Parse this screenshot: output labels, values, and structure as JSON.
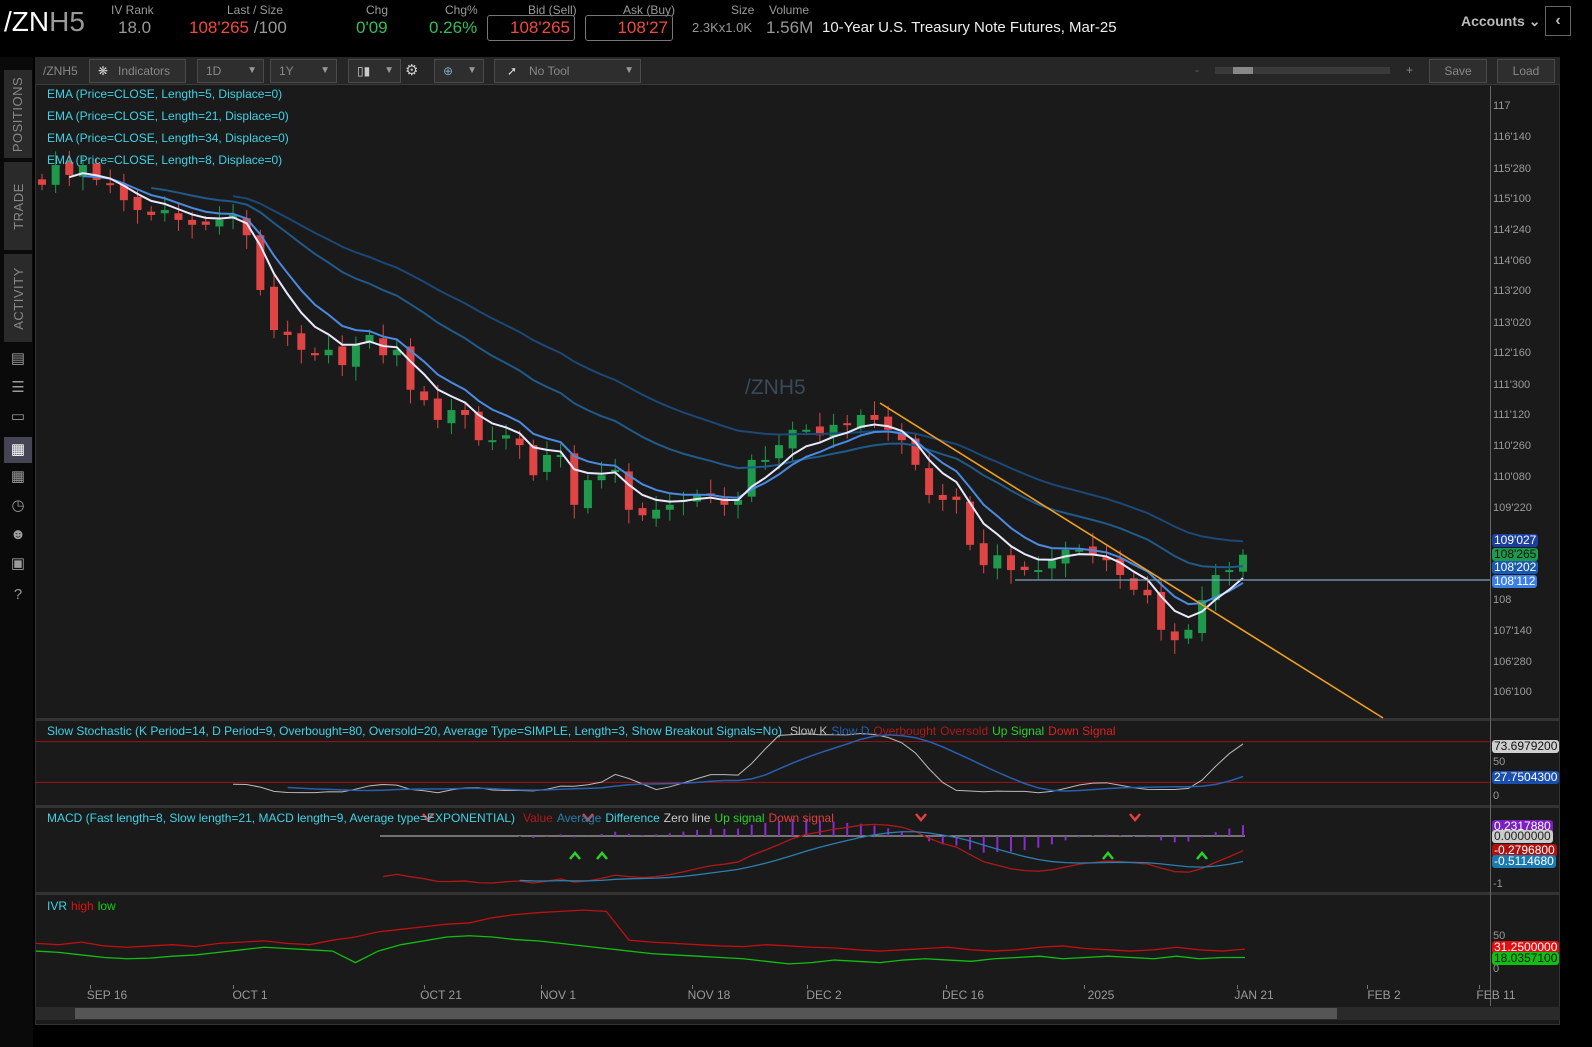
{
  "header": {
    "symbol_prefix": "/ZN",
    "symbol_suffix": "H5",
    "iv_rank_label": "IV Rank",
    "iv_rank": "18.0",
    "last_label": "Last / Size",
    "last": "108'265",
    "size": "/100",
    "chg_label": "Chg",
    "chg": "0'09",
    "chgpct_label": "Chg%",
    "chgpct": "0.26%",
    "bid_label": "Bid (Sell)",
    "bid": "108'265",
    "ask_label": "Ask (Buy)",
    "ask": "108'27",
    "size_label": "Size",
    "size_val": "2.3Kx1.0K",
    "volume_label": "Volume",
    "volume": "1.56M",
    "description": "10-Year U.S. Treasury Note Futures, Mar-25",
    "accounts": "Accounts"
  },
  "sidebar": {
    "tabs": [
      "POSITIONS",
      "TRADE",
      "ACTIVITY"
    ]
  },
  "toolbar": {
    "symbol": "/ZNH5",
    "indicators": "Indicators",
    "aggregation": "1D",
    "timeframe": "1Y",
    "tool": "No Tool",
    "zoom_minus": "-",
    "zoom_plus": "+",
    "save": "Save",
    "load": "Load"
  },
  "chart": {
    "watermark": "/ZNH5",
    "legends": [
      "EMA (Price=CLOSE, Length=5, Displace=0)",
      "EMA (Price=CLOSE, Length=21, Displace=0)",
      "EMA (Price=CLOSE, Length=34, Displace=0)",
      "EMA (Price=CLOSE, Length=8, Displace=0)"
    ],
    "price_ticks": [
      "117",
      "116'140",
      "115'280",
      "115'100",
      "114'240",
      "114'060",
      "113'200",
      "113'020",
      "112'160",
      "111'300",
      "111'120",
      "110'260",
      "110'080",
      "109'220",
      "108",
      "107'140",
      "106'280",
      "106'100"
    ],
    "price_tags": [
      {
        "text": "109'027",
        "color": "#1a3fa0"
      },
      {
        "text": "108'265",
        "color": "#1f9a4c"
      },
      {
        "text": "108'202",
        "color": "#1a5ab0"
      },
      {
        "text": "108'112",
        "color": "#3a7ee8"
      }
    ],
    "date_labels": [
      "SEP 16",
      "OCT 1",
      "OCT 21",
      "NOV 1",
      "NOV 18",
      "DEC 2",
      "DEC 16",
      "2025",
      "JAN 21",
      "FEB 2",
      "FEB 11"
    ]
  },
  "stochastic": {
    "title": "Slow Stochastic (K Period=14, D Period=9, Overbought=80, Oversold=20, Average Type=SIMPLE, Length=3, Show Breakout Signals=No)",
    "series": [
      {
        "label": "Slow K",
        "color": "#bbbbbb"
      },
      {
        "label": "Slow D",
        "color": "#2a5fb0"
      },
      {
        "label": "Overbought",
        "color": "#b01818"
      },
      {
        "label": "Oversold",
        "color": "#b01818"
      },
      {
        "label": "Up Signal",
        "color": "#2bd12b"
      },
      {
        "label": "Down Signal",
        "color": "#e02020"
      }
    ],
    "ticks": [
      "50",
      "0"
    ],
    "tags": [
      {
        "text": "73.6979200",
        "color": "#cfcfcf",
        "fg": "#111"
      },
      {
        "text": "27.7504300",
        "color": "#1a4fb0",
        "fg": "#fff"
      }
    ]
  },
  "macd": {
    "title": "MACD (Fast length=8, Slow length=21, MACD length=9, Average type=EXPONENTIAL)",
    "series": [
      {
        "label": "Value",
        "color": "#b01818"
      },
      {
        "label": "Average",
        "color": "#2a7fb0"
      },
      {
        "label": "Difference",
        "color": "#3fd2e6"
      },
      {
        "label": "Zero line",
        "color": "#cccccc"
      },
      {
        "label": "Up signal",
        "color": "#2bd12b"
      },
      {
        "label": "Down signal",
        "color": "#e04040"
      }
    ],
    "ticks": [
      "-1"
    ],
    "tags": [
      {
        "text": "0.2317880",
        "color": "#7a1fc0",
        "fg": "#fff"
      },
      {
        "text": "0.0000000",
        "color": "#cccccc",
        "fg": "#222"
      },
      {
        "text": "-0.2796800",
        "color": "#b01010",
        "fg": "#fff"
      },
      {
        "text": "-0.5114680",
        "color": "#1a7ab0",
        "fg": "#fff"
      }
    ]
  },
  "ivr": {
    "title": "IVR",
    "high_label": "high",
    "low_label": "low",
    "ticks": [
      "50",
      "0"
    ],
    "tags": [
      {
        "text": "31.2500000",
        "color": "#e01010",
        "fg": "#fff"
      },
      {
        "text": "18.0357100",
        "color": "#10c010",
        "fg": "#111"
      }
    ]
  },
  "colors": {
    "up": "#1f9a4c",
    "down": "#e04545",
    "ema5": "#e8e8ff",
    "ema8": "#4a8ae0",
    "ema21": "#1f5a8a",
    "ema34": "#1a4878",
    "trend": "#f0a020"
  },
  "chart_data": {
    "type": "candlestick",
    "title": "/ZNH5 1D",
    "x_range": [
      "SEP 2024",
      "JAN 21 2025"
    ],
    "ylim": [
      106.3,
      117.2
    ],
    "closes": [
      115.58,
      115.94,
      115.76,
      115.94,
      115.67,
      115.58,
      115.3,
      115.12,
      115.03,
      115.12,
      114.94,
      114.85,
      114.85,
      114.94,
      115.03,
      114.66,
      113.66,
      112.93,
      112.84,
      112.57,
      112.47,
      112.57,
      112.29,
      112.66,
      112.84,
      112.47,
      112.57,
      111.84,
      111.65,
      111.29,
      111.47,
      111.38,
      110.92,
      110.92,
      111.01,
      110.83,
      110.28,
      110.65,
      110.65,
      109.74,
      110.19,
      110.28,
      110.38,
      109.65,
      109.55,
      109.65,
      109.74,
      109.83,
      109.92,
      109.92,
      109.74,
      109.83,
      110.56,
      110.56,
      110.83,
      111.11,
      111.11,
      111.01,
      111.2,
      111.2,
      111.38,
      111.29,
      111.11,
      110.92,
      110.47,
      109.92,
      109.83,
      109.83,
      109.01,
      108.64,
      108.82,
      108.55,
      108.55,
      108.55,
      108.73,
      108.92,
      108.92,
      108.82,
      108.73,
      108.46,
      108.19,
      108.09,
      107.46,
      107.27,
      107.46,
      108.0,
      108.46,
      108.55,
      108.83
    ],
    "ivr_high": [
      40,
      38,
      42,
      36,
      34,
      36,
      38,
      35,
      40,
      42,
      44,
      40,
      38,
      45,
      50,
      58,
      62,
      66,
      70,
      72,
      80,
      85,
      88,
      90,
      92,
      90,
      45,
      42,
      40,
      38,
      36,
      35,
      38,
      36,
      34,
      33,
      30,
      28,
      30,
      32,
      34,
      30,
      28,
      30,
      34,
      36,
      32,
      30,
      28,
      30,
      34,
      30,
      28,
      31
    ],
    "ivr_low": [
      28,
      26,
      22,
      18,
      16,
      17,
      20,
      22,
      26,
      30,
      34,
      32,
      30,
      28,
      10,
      28,
      38,
      44,
      50,
      52,
      50,
      46,
      44,
      40,
      36,
      32,
      28,
      24,
      22,
      20,
      18,
      16,
      12,
      8,
      10,
      14,
      12,
      10,
      14,
      16,
      14,
      12,
      16,
      18,
      20,
      16,
      18,
      20,
      18,
      16,
      20,
      16,
      18,
      18
    ]
  }
}
